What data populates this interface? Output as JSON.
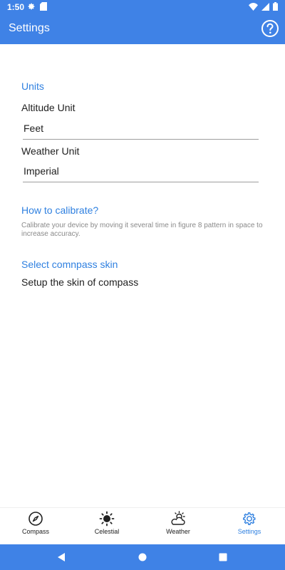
{
  "status_bar": {
    "time": "1:50"
  },
  "app_bar": {
    "title": "Settings"
  },
  "settings": {
    "units_header": "Units",
    "altitude_label": "Altitude Unit",
    "altitude_value": "Feet",
    "weather_label": "Weather Unit",
    "weather_value": "Imperial",
    "calibrate_header": "How to  calibrate?",
    "calibrate_desc": "Calibrate your device by moving it several time in figure 8 pattern in space to increase accuracy.",
    "skin_header": "Select comnpass skin",
    "skin_desc": "Setup the skin of compass"
  },
  "bottom_nav": {
    "items": [
      {
        "label": "Compass",
        "icon": "compass-icon"
      },
      {
        "label": "Celestial",
        "icon": "sun-icon"
      },
      {
        "label": "Weather",
        "icon": "weather-icon"
      },
      {
        "label": "Settings",
        "icon": "gear-icon"
      }
    ]
  },
  "colors": {
    "primary": "#3f82e6",
    "accent": "#2f80e0"
  }
}
